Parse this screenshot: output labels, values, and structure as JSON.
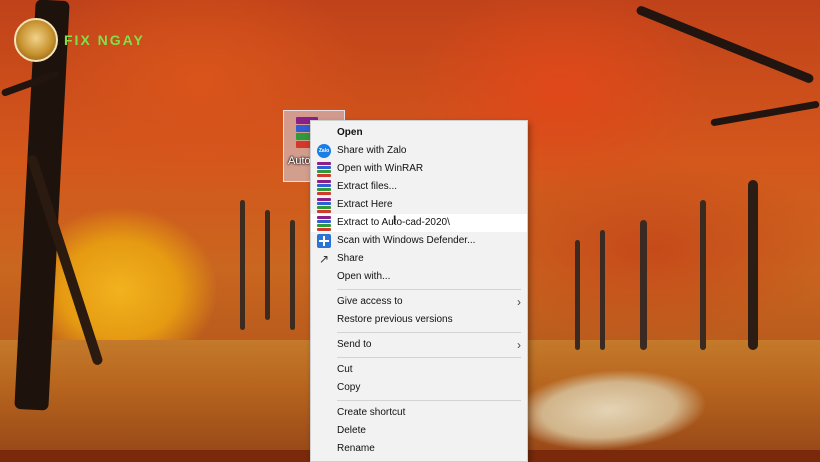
{
  "desktop": {
    "logo_text": "FIX NGAY",
    "file_icon_label": "Auto"
  },
  "menu": {
    "items": [
      {
        "label": "Open",
        "icon": "none",
        "bold": true
      },
      {
        "label": "Share with Zalo",
        "icon": "zalo-icon",
        "icon_text": "Zalo"
      },
      {
        "label": "Open with WinRAR",
        "icon": "winrar-icon"
      },
      {
        "label": "Extract files...",
        "icon": "winrar-icon"
      },
      {
        "label": "Extract Here",
        "icon": "winrar-icon"
      },
      {
        "label": "Extract to Auto-cad-2020\\",
        "icon": "winrar-icon",
        "hover": true
      },
      {
        "label": "Scan with Windows Defender...",
        "icon": "defender-icon"
      },
      {
        "label": "Share",
        "icon": "share-icon"
      },
      {
        "label": "Open with...",
        "icon": "none"
      },
      {
        "label": "Give access to",
        "icon": "none",
        "submenu": true
      },
      {
        "label": "Restore previous versions",
        "icon": "none"
      },
      {
        "label": "Send to",
        "icon": "none",
        "submenu": true
      },
      {
        "label": "Cut",
        "icon": "none"
      },
      {
        "label": "Copy",
        "icon": "none"
      },
      {
        "label": "Create shortcut",
        "icon": "none"
      },
      {
        "label": "Delete",
        "icon": "none"
      },
      {
        "label": "Rename",
        "icon": "none"
      }
    ],
    "submenu_glyph": "›",
    "share_glyph": "↗"
  },
  "colors": {
    "menu_bg": "#f2f2f2",
    "hover_bg": "#ffffff",
    "winrar_stripes": [
      "#8a1f8c",
      "#2f5fd0",
      "#2f9a3a",
      "#d03a2a"
    ]
  }
}
